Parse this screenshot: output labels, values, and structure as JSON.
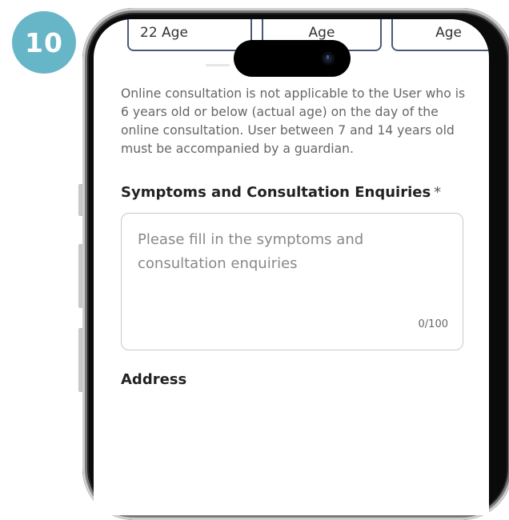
{
  "step": {
    "number": "10",
    "color": "#67b6c8"
  },
  "age_options": [
    "22 Age",
    "Age",
    "Age"
  ],
  "notice": "Online consultation is not applicable to the User who is 6 years old or below (actual age) on the day of the online consultation. User between 7 and 14 years old must be accompanied by a guardian.",
  "symptoms": {
    "title": "Symptoms and Consultation Enquiries",
    "required_mark": "*",
    "placeholder": "Please fill in the symptoms and consultation enquiries",
    "counter": "0/100"
  },
  "address": {
    "title": "Address"
  }
}
